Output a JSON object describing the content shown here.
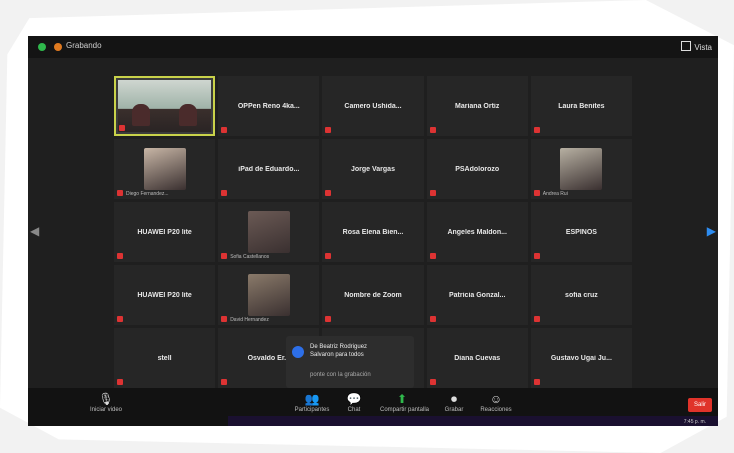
{
  "window": {
    "title": "Grabando",
    "view_label": "Vista"
  },
  "tiles": [
    {
      "type": "active",
      "name": "",
      "label": ""
    },
    {
      "type": "name",
      "name": "OPPen Reno 4ka...",
      "label": ""
    },
    {
      "type": "name",
      "name": "Camero Ushida...",
      "label": ""
    },
    {
      "type": "name",
      "name": "Mariana Ortiz",
      "label": ""
    },
    {
      "type": "name",
      "name": "Laura Benites",
      "label": ""
    },
    {
      "type": "video",
      "name": "",
      "label": "Diego Fernandez...",
      "color": "#c8b6a6"
    },
    {
      "type": "name",
      "name": "iPad de Eduardo...",
      "label": ""
    },
    {
      "type": "name",
      "name": "Jorge Vargas",
      "label": ""
    },
    {
      "type": "name",
      "name": "PSAdolorozo",
      "label": ""
    },
    {
      "type": "video",
      "name": "",
      "label": "Andrea Rui",
      "color": "#b7b0a2"
    },
    {
      "type": "name",
      "name": "HUAWEI P20 lite",
      "label": ""
    },
    {
      "type": "video",
      "name": "",
      "label": "Sofia Castellanos",
      "color": "#6b5a55"
    },
    {
      "type": "name",
      "name": "Rosa Elena Bien...",
      "label": ""
    },
    {
      "type": "name",
      "name": "Angeles Maldon...",
      "label": ""
    },
    {
      "type": "name",
      "name": "ESPINOS",
      "label": ""
    },
    {
      "type": "name",
      "name": "HUAWEI P20 lite",
      "label": ""
    },
    {
      "type": "video",
      "name": "",
      "label": "David Hernandez",
      "color": "#8a7a6a"
    },
    {
      "type": "name",
      "name": "Nombre de Zoom",
      "label": ""
    },
    {
      "type": "name",
      "name": "Patricia Gonzal...",
      "label": ""
    },
    {
      "type": "name",
      "name": "sofia cruz",
      "label": ""
    },
    {
      "type": "name",
      "name": "stell",
      "label": ""
    },
    {
      "type": "name",
      "name": "Osvaldo Er...",
      "label": ""
    },
    {
      "type": "empty",
      "name": "",
      "label": ""
    },
    {
      "type": "name",
      "name": "Diana Cuevas",
      "label": ""
    },
    {
      "type": "name",
      "name": "Gustavo Ugai Ju...",
      "label": ""
    }
  ],
  "popup": {
    "line1": "De Beatriz Rodriguez",
    "line2": "Salvaron para todos",
    "line3": "ponte con la grabación"
  },
  "toolbar": [
    {
      "icon": "🎙",
      "label": "Iniciar video",
      "name": "start-video-button"
    },
    {
      "icon": "👥",
      "label": "Participantes",
      "name": "participants-button"
    },
    {
      "icon": "💬",
      "label": "Chat",
      "name": "chat-button"
    },
    {
      "icon": "⬆",
      "label": "Compartir pantalla",
      "name": "share-screen-button",
      "green": true
    },
    {
      "icon": "⏺",
      "label": "Grabar",
      "name": "record-button"
    },
    {
      "icon": "☺",
      "label": "Reacciones",
      "name": "reactions-button"
    }
  ],
  "leave_label": "Salir",
  "clock": "7:45 p. m."
}
